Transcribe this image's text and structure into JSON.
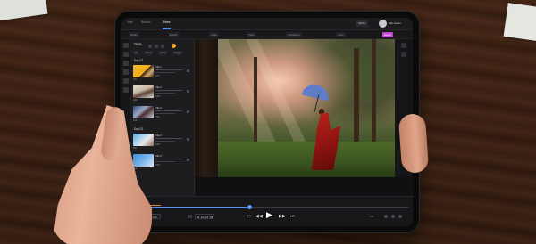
{
  "header": {
    "tabs": [
      {
        "label": "View",
        "active": false
      },
      {
        "label": "Review",
        "active": false
      },
      {
        "label": "Share",
        "active": true
      }
    ],
    "action_button": "SAVE",
    "user_name": "Max Aiden"
  },
  "subbar": {
    "tabs": [
      "Media",
      "Effects",
      "Audio",
      "Titles",
      "Transitions",
      "Color",
      "Export"
    ],
    "active_index": 6
  },
  "media_panel": {
    "title": "Media",
    "filters": [
      "All",
      "Video",
      "Audio",
      "Images"
    ],
    "groups": [
      {
        "name": "Day 07",
        "clips": [
          {
            "title": "Clip 1",
            "duration": "0:14",
            "label": "A01"
          },
          {
            "title": "Clip 2",
            "duration": "0:08",
            "label": "A02"
          },
          {
            "title": "Clip 3",
            "duration": "0:11",
            "label": "A03"
          }
        ]
      },
      {
        "name": "Day 02",
        "clips": [
          {
            "title": "Clip 4",
            "duration": "0:09",
            "label": "B01"
          },
          {
            "title": "Clip 5",
            "duration": "0:06",
            "label": "B02"
          }
        ]
      }
    ]
  },
  "timeline": {
    "left_buttons": [
      "SPEED",
      "LOOP"
    ],
    "timecode": "00:01:23:08",
    "transport": [
      "⏮",
      "◀◀",
      "▶",
      "▶▶",
      "⏭"
    ],
    "right_label": "FIT",
    "progress_fraction": 0.44
  },
  "colors": {
    "accent_blue": "#4d8dff",
    "accent_magenta": "#c043d6",
    "accent_orange": "#e08a2a"
  },
  "icons": [
    "folder-icon",
    "grid-icon",
    "list-icon",
    "search-icon",
    "play-icon",
    "skip-back-icon",
    "skip-forward-icon",
    "rewind-icon",
    "fast-forward-icon",
    "settings-icon"
  ]
}
